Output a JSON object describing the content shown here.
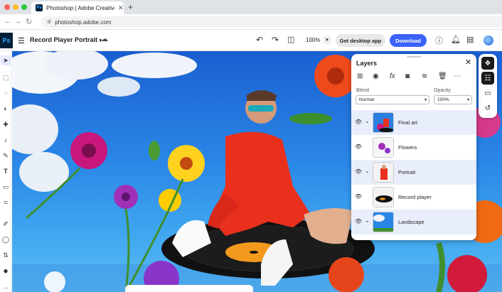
{
  "browser": {
    "tab_title": "Photoshop | Adobe Creative C",
    "tab_favicon": "Ps",
    "new_tab_label": "+",
    "url": "photoshop.adobe.com",
    "colors": {
      "close": "#ff5f57",
      "minimize": "#febc2e",
      "maximize": "#28c840"
    }
  },
  "header": {
    "app_logo": "Ps",
    "document_title": "Record Player Portrait",
    "zoom": "100%",
    "desktop_button": "Get desktop app",
    "download_button": "Download",
    "accent_color": "#3b63fb"
  },
  "layers_panel": {
    "title": "Layers",
    "blend_label": "Blend",
    "blend_value": "Normal",
    "opacity_label": "Opacity",
    "opacity_value": "100%",
    "layers": [
      {
        "name": "Final art",
        "selected": true,
        "expandable": true
      },
      {
        "name": "Flowers",
        "selected": false,
        "expandable": false
      },
      {
        "name": "Portrait",
        "selected": true,
        "expandable": true
      },
      {
        "name": "Record player",
        "selected": false,
        "expandable": false
      },
      {
        "name": "Landscape",
        "selected": true,
        "expandable": true
      }
    ]
  },
  "icons": {
    "left_tools": [
      "move-icon",
      "select-icon",
      "lasso-icon",
      "quick-select-icon",
      "healing-icon",
      "stamp-icon",
      "brush-icon",
      "type-icon",
      "shape-icon",
      "crop-icon",
      "eyedropper-icon",
      "color-swap-icon",
      "foreground-color-icon",
      "more-icon"
    ],
    "right_rail": [
      "layers-icon",
      "adjustments-icon",
      "comments-icon",
      "history-icon"
    ]
  }
}
